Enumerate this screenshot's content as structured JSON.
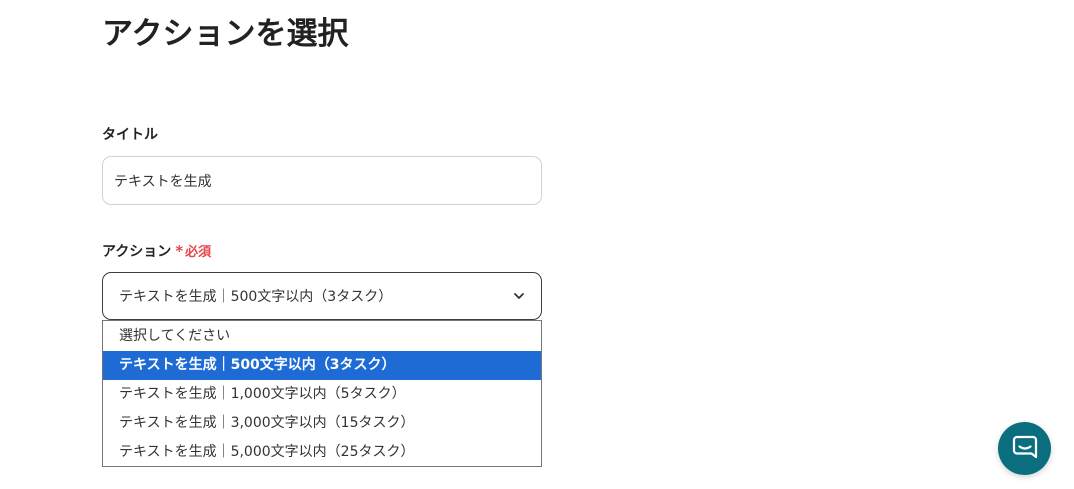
{
  "page": {
    "title": "アクションを選択"
  },
  "form": {
    "title_label": "タイトル",
    "title_value": "テキストを生成",
    "action_label": "アクション",
    "required_star": "*",
    "required_text": "必須",
    "action_selected": "テキストを生成｜500文字以内（3タスク）",
    "options": [
      "選択してください",
      "テキストを生成｜500文字以内（3タスク）",
      "テキストを生成｜1,000文字以内（5タスク）",
      "テキストを生成｜3,000文字以内（15タスク）",
      "テキストを生成｜5,000文字以内（25タスク）"
    ],
    "highlighted_option_index": 1
  },
  "colors": {
    "accent": "#1e6bd6",
    "required": "#e5484d",
    "chat_button": "#0b6e7f"
  },
  "icons": {
    "select_chevron": "chevron-down-icon",
    "chat": "chat-bubble-icon"
  }
}
